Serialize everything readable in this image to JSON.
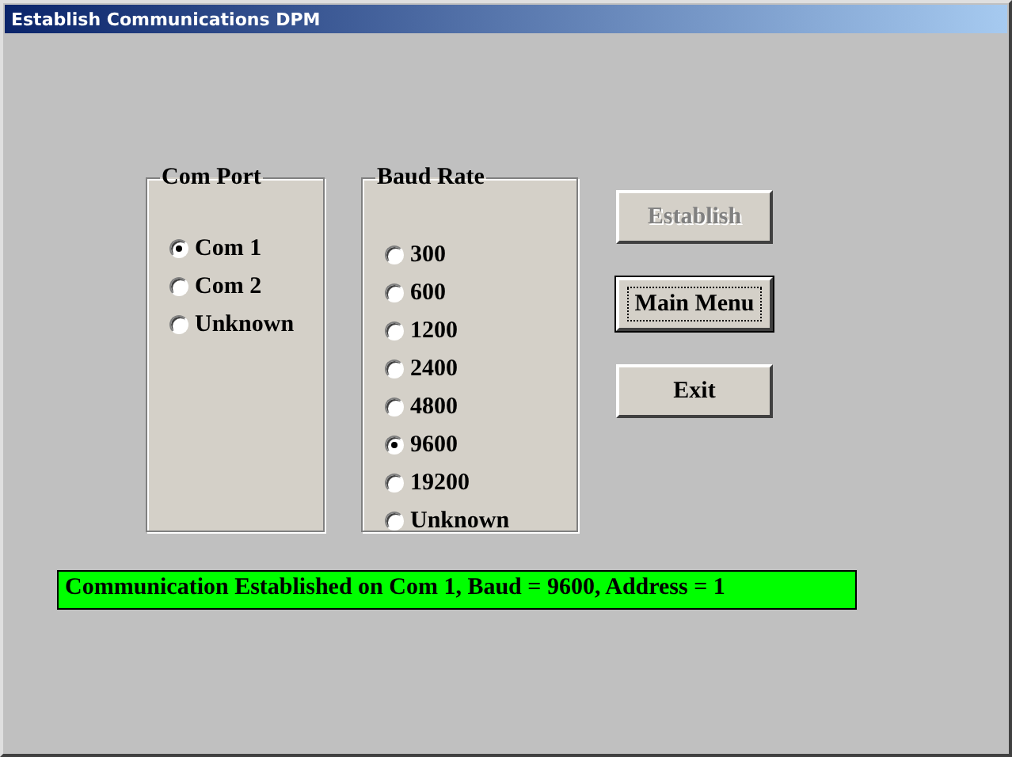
{
  "window": {
    "title": "Establish Communications DPM"
  },
  "com_port": {
    "title": "Com Port",
    "options": [
      {
        "label": "Com 1",
        "selected": true
      },
      {
        "label": "Com 2",
        "selected": false
      },
      {
        "label": "Unknown",
        "selected": false
      }
    ]
  },
  "baud_rate": {
    "title": "Baud Rate",
    "options": [
      {
        "label": "300",
        "selected": false
      },
      {
        "label": "600",
        "selected": false
      },
      {
        "label": "1200",
        "selected": false
      },
      {
        "label": "2400",
        "selected": false
      },
      {
        "label": "4800",
        "selected": false
      },
      {
        "label": "9600",
        "selected": true
      },
      {
        "label": "19200",
        "selected": false
      },
      {
        "label": "Unknown",
        "selected": false
      }
    ]
  },
  "buttons": [
    {
      "label": "Establish",
      "disabled": true,
      "focused": false
    },
    {
      "label": "Main Menu",
      "disabled": false,
      "focused": true
    },
    {
      "label": "Exit",
      "disabled": false,
      "focused": false
    }
  ],
  "status": {
    "text": "Communication Established on Com 1, Baud = 9600, Address = 1"
  }
}
